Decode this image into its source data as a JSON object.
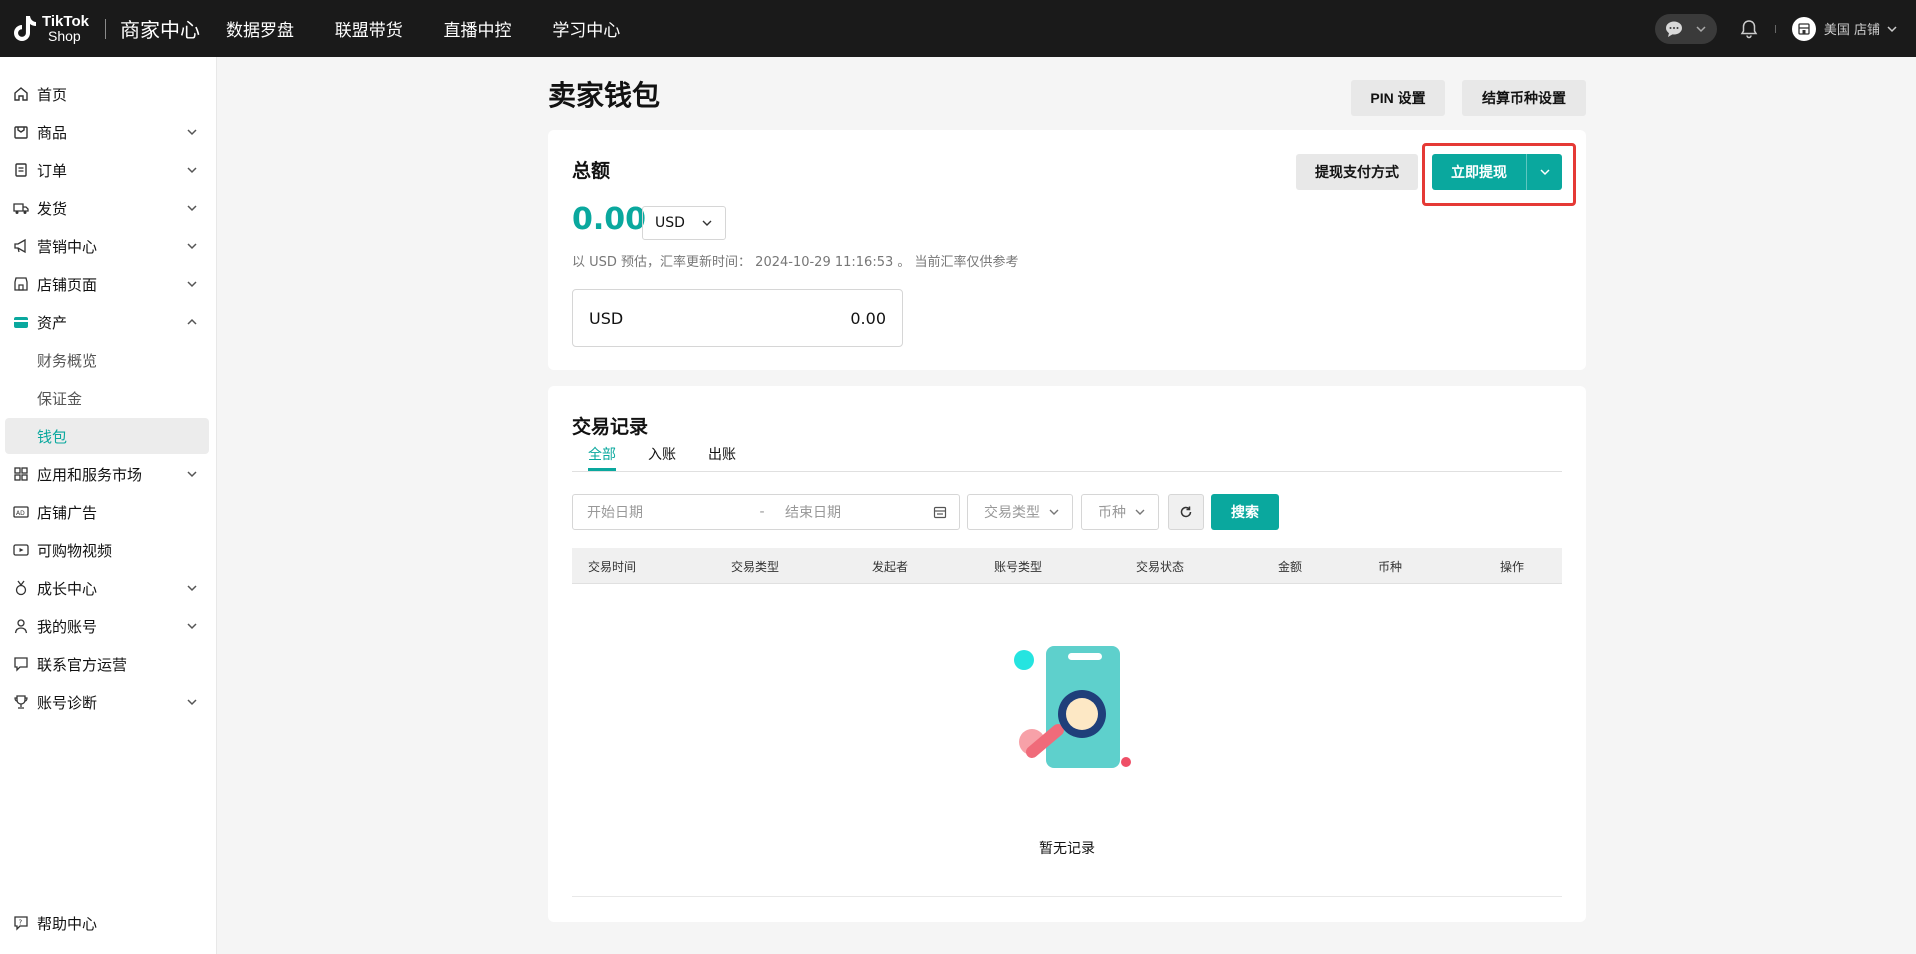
{
  "topbar": {
    "logo_tiktok": "TikTok",
    "logo_shop": "Shop",
    "title": "商家中心",
    "nav": [
      "数据罗盘",
      "联盟带货",
      "直播中控",
      "学习中心"
    ],
    "shop_name": "美国 店铺"
  },
  "sidebar": {
    "items": [
      {
        "label": "首页",
        "icon": "home-icon"
      },
      {
        "label": "商品",
        "icon": "product-icon"
      },
      {
        "label": "订单",
        "icon": "order-icon"
      },
      {
        "label": "发货",
        "icon": "truck-icon"
      },
      {
        "label": "营销中心",
        "icon": "megaphone-icon"
      },
      {
        "label": "店铺页面",
        "icon": "store-icon"
      },
      {
        "label": "资产",
        "icon": "wallet-icon"
      },
      {
        "label": "财务概览"
      },
      {
        "label": "保证金"
      },
      {
        "label": "钱包"
      },
      {
        "label": "应用和服务市场",
        "icon": "apps-icon"
      },
      {
        "label": "店铺广告",
        "icon": "ad-icon"
      },
      {
        "label": "可购物视频",
        "icon": "video-icon"
      },
      {
        "label": "成长中心",
        "icon": "medal-icon"
      },
      {
        "label": "我的账号",
        "icon": "user-icon"
      },
      {
        "label": "联系官方运营",
        "icon": "chat-icon"
      },
      {
        "label": "账号诊断",
        "icon": "trophy-icon"
      }
    ],
    "help": "帮助中心"
  },
  "page": {
    "title": "卖家钱包",
    "pin_button": "PIN 设置",
    "currency_settings_button": "结算币种设置"
  },
  "balance": {
    "title": "总额",
    "amount": "0.00",
    "currency": "USD",
    "rate_note": "以 USD 预估，汇率更新时间： 2024-10-29 11:16:53 。 当前汇率仅供参考",
    "box_currency": "USD",
    "box_amount": "0.00",
    "payment_method_button": "提现支付方式",
    "withdraw_button": "立即提现"
  },
  "transactions": {
    "title": "交易记录",
    "tabs": [
      "全部",
      "入账",
      "出账"
    ],
    "start_date_placeholder": "开始日期",
    "date_sep": "-",
    "end_date_placeholder": "结束日期",
    "type_select": "交易类型",
    "currency_select": "币种",
    "search_button": "搜索",
    "columns": [
      "交易时间",
      "交易类型",
      "发起者",
      "账号类型",
      "交易状态",
      "金额",
      "币种",
      "操作"
    ],
    "empty_text": "暂无记录"
  },
  "colors": {
    "accent": "#0aa89e",
    "highlight": "#e53935",
    "topbar": "#1a1a1a"
  }
}
